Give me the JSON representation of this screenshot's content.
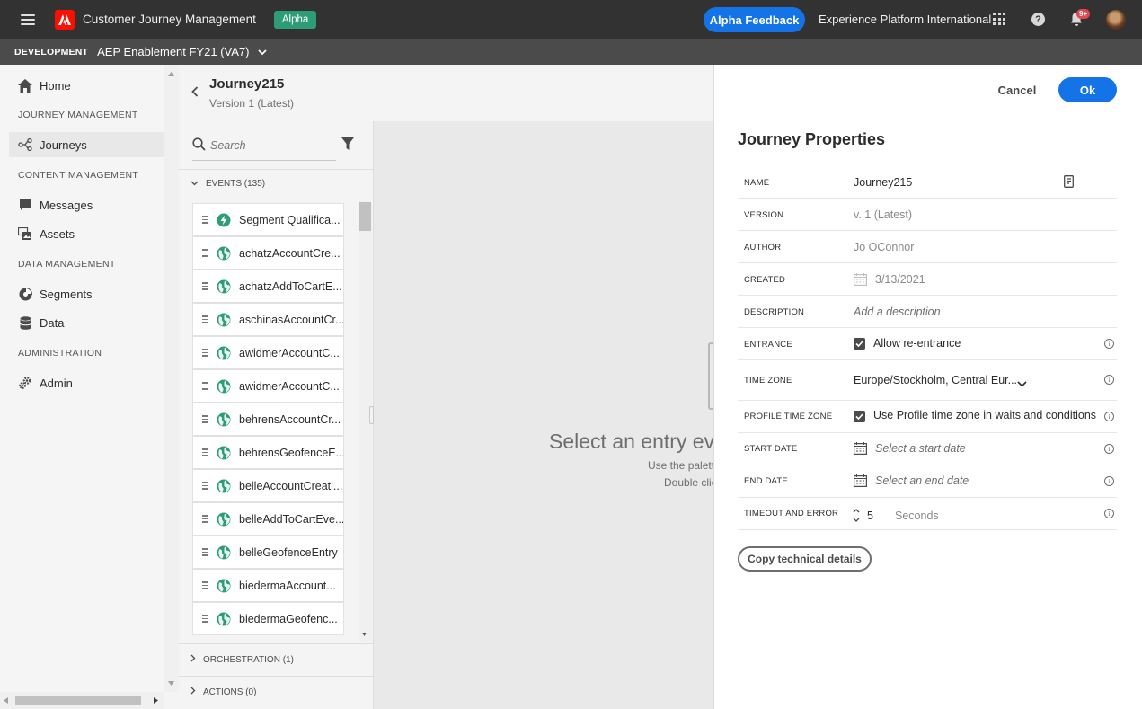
{
  "topbar": {
    "app_title": "Customer Journey Management",
    "alpha_badge": "Alpha",
    "feedback_button": "Alpha Feedback",
    "org_name": "Experience Platform International",
    "notification_count": "9+"
  },
  "subbar": {
    "environment": "DEVELOPMENT",
    "sandbox": "AEP Enablement FY21 (VA7)"
  },
  "nav": {
    "home": "Home",
    "section_journey": "JOURNEY MANAGEMENT",
    "journeys": "Journeys",
    "section_content": "CONTENT MANAGEMENT",
    "messages": "Messages",
    "assets": "Assets",
    "section_data": "DATA MANAGEMENT",
    "segments": "Segments",
    "data": "Data",
    "section_admin": "ADMINISTRATION",
    "admin": "Admin"
  },
  "journey": {
    "title": "Journey215",
    "version": "Version 1 (Latest)"
  },
  "palette": {
    "search_placeholder": "Search",
    "events_header": "EVENTS (135)",
    "events": [
      {
        "label": "Segment Qualifica...",
        "icon": "segment-qualification-icon"
      },
      {
        "label": "achatzAccountCre...",
        "icon": "globe-icon"
      },
      {
        "label": "achatzAddToCartE...",
        "icon": "globe-icon"
      },
      {
        "label": "aschinasAccountCr...",
        "icon": "globe-icon"
      },
      {
        "label": "awidmerAccountC...",
        "icon": "globe-icon"
      },
      {
        "label": "awidmerAccountC...",
        "icon": "globe-icon"
      },
      {
        "label": "behrensAccountCr...",
        "icon": "globe-icon"
      },
      {
        "label": "behrensGeofenceE...",
        "icon": "globe-icon"
      },
      {
        "label": "belleAccountCreati...",
        "icon": "globe-icon"
      },
      {
        "label": "belleAddToCartEve...",
        "icon": "globe-icon"
      },
      {
        "label": "belleGeofenceEntry",
        "icon": "globe-icon"
      },
      {
        "label": "biedermaAccount...",
        "icon": "globe-icon"
      },
      {
        "label": "biedermaGeofenc...",
        "icon": "globe-icon"
      }
    ],
    "orchestration_header": "ORCHESTRATION (1)",
    "actions_header": "ACTIONS (0)"
  },
  "canvas": {
    "message": "Select an entry eve",
    "sub1": "Use the palette",
    "sub2": "Double clic"
  },
  "properties": {
    "cancel": "Cancel",
    "ok": "Ok",
    "title": "Journey Properties",
    "name_label": "NAME",
    "name_value": "Journey215",
    "version_label": "VERSION",
    "version_value": "v. 1 (Latest)",
    "author_label": "AUTHOR",
    "author_value": "Jo OConnor",
    "created_label": "CREATED",
    "created_value": "3/13/2021",
    "description_label": "DESCRIPTION",
    "description_placeholder": "Add a description",
    "entrance_label": "ENTRANCE",
    "entrance_value": "Allow re-entrance",
    "timezone_label": "TIME ZONE",
    "timezone_value": "Europe/Stockholm, Central Eur...",
    "profile_tz_label": "PROFILE TIME ZONE",
    "profile_tz_value": "Use Profile time zone in waits and conditions",
    "start_date_label": "START DATE",
    "start_date_placeholder": "Select a start date",
    "end_date_label": "END DATE",
    "end_date_placeholder": "Select an end date",
    "timeout_label": "TIMEOUT AND ERROR",
    "timeout_value": "5",
    "timeout_unit": "Seconds",
    "copy_button": "Copy technical details"
  },
  "colors": {
    "accent": "#1473e6",
    "topbar": "#323232",
    "subbar": "#4b4b4b",
    "alpha_badge": "#2d9d78",
    "event_icon": "#2d9d78"
  }
}
